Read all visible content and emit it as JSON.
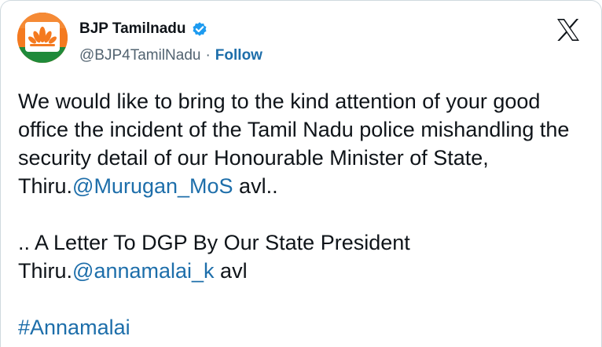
{
  "author": {
    "display_name": "BJP Tamilnadu",
    "handle": "@BJP4TamilNadu",
    "separator": "·",
    "follow_label": "Follow",
    "verified": true
  },
  "tweet": {
    "para1_text": "We would like to bring to the kind attention of your good office the incident of the Tamil Nadu police mishandling the security detail of our Honourable Minister of State, Thiru.",
    "para1_mention": "@Murugan_MoS",
    "para1_suffix": " avl..",
    "para2_text": ".. A Letter To DGP By Our State President Thiru.",
    "para2_mention": "@annamalai_k",
    "para2_suffix": " avl",
    "hashtag": "#Annamalai"
  },
  "colors": {
    "link": "#1d6eaa",
    "verified_badge": "#1d9bf0",
    "avatar_bg": "#f47a20"
  },
  "icons": {
    "avatar": "bjp-lotus-logo",
    "verified": "verified-badge-icon",
    "brand": "x-logo-icon"
  }
}
